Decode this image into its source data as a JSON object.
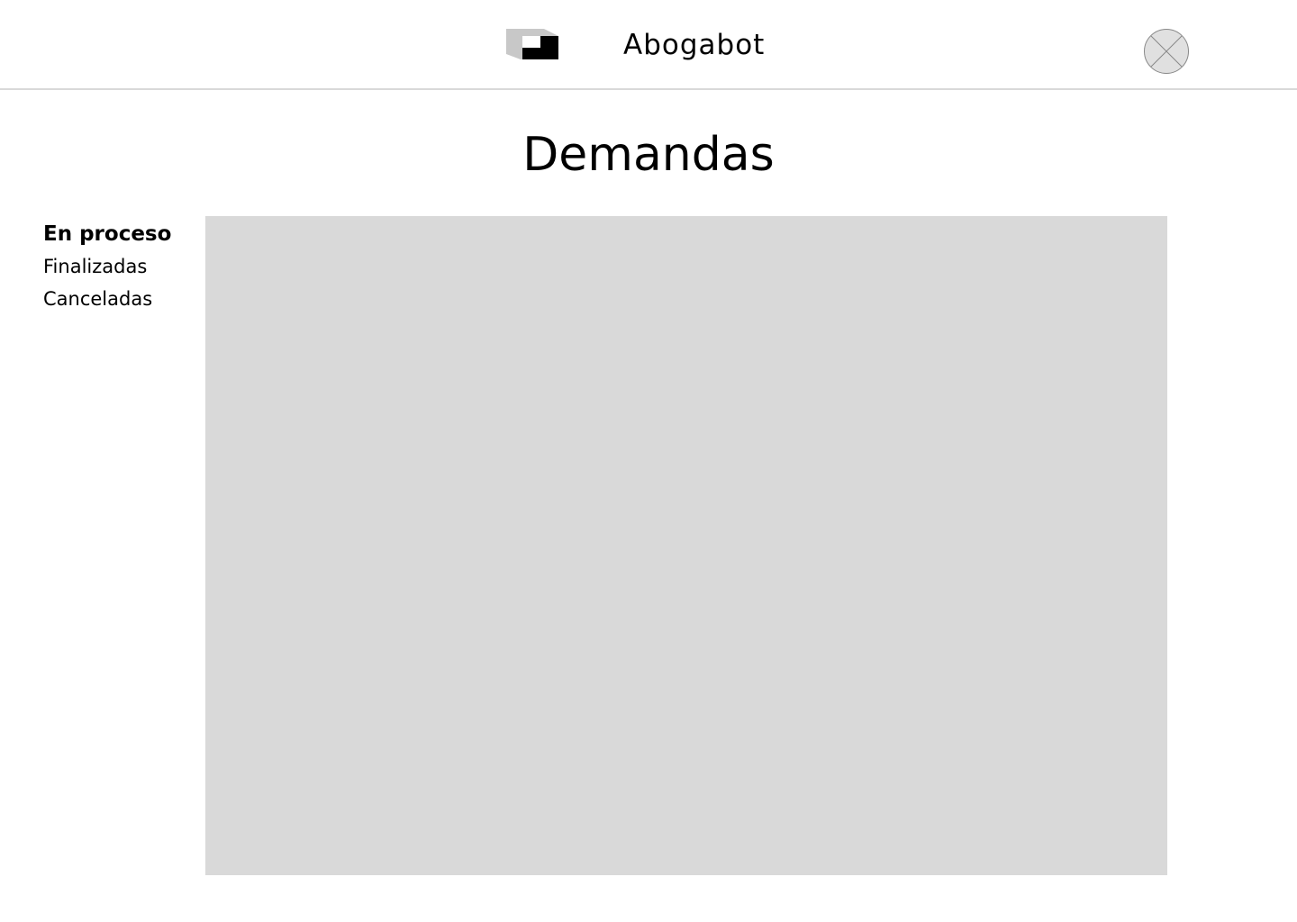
{
  "header": {
    "app_name": "Abogabot",
    "logo_icon": "abogabot-logo-icon",
    "avatar_icon": "avatar-placeholder-icon"
  },
  "page": {
    "title": "Demandas"
  },
  "sidebar": {
    "items": [
      {
        "label": "En proceso",
        "active": true
      },
      {
        "label": "Finalizadas",
        "active": false
      },
      {
        "label": "Canceladas",
        "active": false
      }
    ]
  },
  "colors": {
    "panel_background": "#d9d9d9",
    "divider": "#d9d9d9",
    "text": "#000000",
    "logo_light": "#c8c8c8",
    "logo_dark": "#000000"
  }
}
